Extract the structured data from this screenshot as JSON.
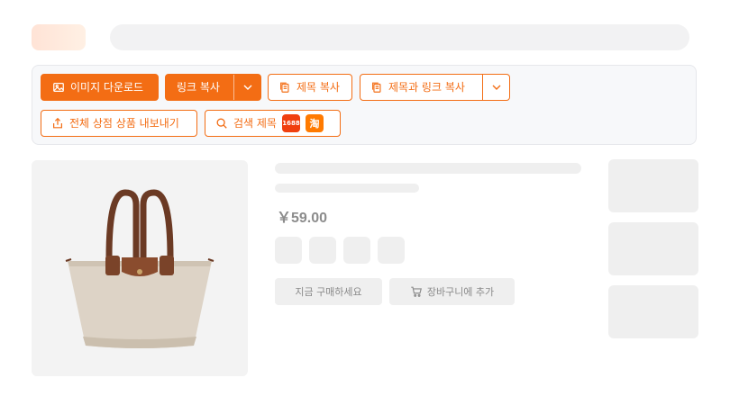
{
  "toolbar": {
    "download_images": "이미지 다운로드",
    "copy_link": "링크 복사",
    "copy_title": "제목 복사",
    "copy_title_link": "제목과 링크 복사",
    "export_store": "전체 상점 상품 내보내기",
    "search_title": "검색 제목",
    "badge_1688": "1688",
    "badge_taobao": "淘"
  },
  "product": {
    "price": "￥59.00",
    "buy_now": "지금 구매하세요",
    "add_to_cart": "장바구니에 추가"
  },
  "colors": {
    "accent": "#f36d14",
    "skeleton": "#efefef"
  }
}
